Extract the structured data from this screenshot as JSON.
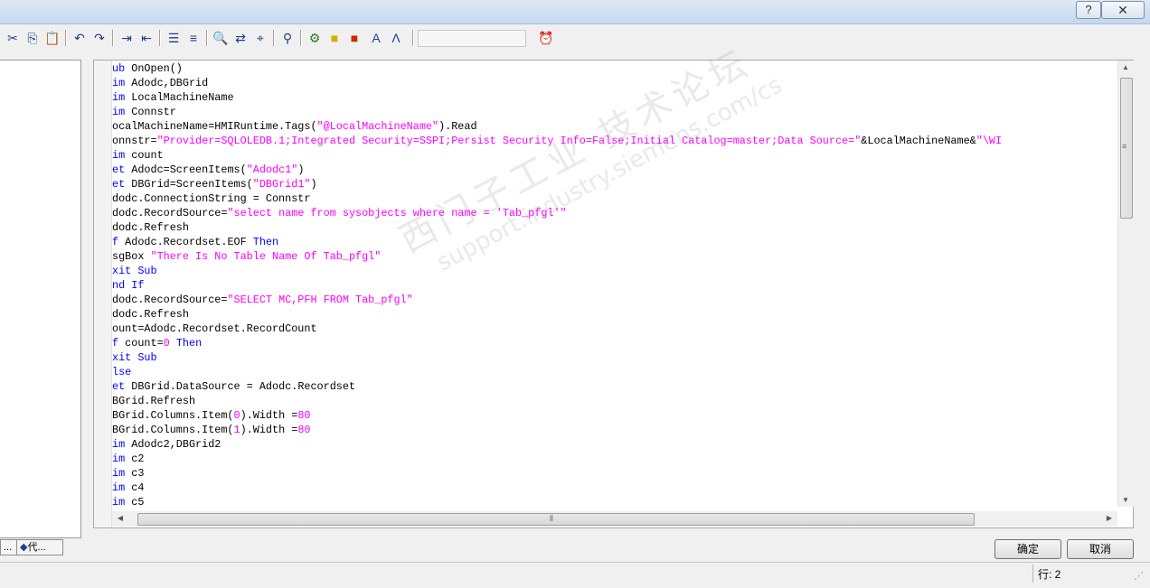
{
  "window": {
    "title": "",
    "help_label": "?",
    "close_label": "✕"
  },
  "toolbar": {
    "buttons": [
      {
        "name": "cut-button",
        "icon": "scissors-icon",
        "glyph": "✂"
      },
      {
        "name": "copy-button",
        "icon": "copy-icon",
        "glyph": "⎘"
      },
      {
        "name": "paste-button",
        "icon": "paste-icon",
        "glyph": "📋"
      },
      {
        "name": "undo-button",
        "icon": "undo-icon",
        "glyph": "↶"
      },
      {
        "name": "redo-button",
        "icon": "redo-icon",
        "glyph": "↷"
      },
      {
        "name": "indent-button",
        "icon": "indent-icon",
        "glyph": "⇥"
      },
      {
        "name": "outdent-button",
        "icon": "outdent-icon",
        "glyph": "⇤"
      },
      {
        "name": "comment-button",
        "icon": "comment-lines-icon",
        "glyph": "☰"
      },
      {
        "name": "uncomment-button",
        "icon": "uncomment-lines-icon",
        "glyph": "≡"
      },
      {
        "name": "find-button",
        "icon": "binoculars-icon",
        "glyph": "🔍"
      },
      {
        "name": "replace-button",
        "icon": "replace-icon",
        "glyph": "⇄"
      },
      {
        "name": "goto-button",
        "icon": "goto-icon",
        "glyph": "⌖"
      },
      {
        "name": "bookmark-button",
        "icon": "bookmark-icon",
        "glyph": "⚲"
      },
      {
        "name": "compile-button",
        "icon": "compile-icon",
        "glyph": "⚙"
      },
      {
        "name": "object-button",
        "icon": "yellow-cube-icon",
        "glyph": "■"
      },
      {
        "name": "object-red-button",
        "icon": "red-cube-icon",
        "glyph": "■"
      },
      {
        "name": "tags-button",
        "icon": "tag-a-icon",
        "glyph": "A"
      },
      {
        "name": "property-button",
        "icon": "compass-icon",
        "glyph": "Λ"
      },
      {
        "name": "timer-button",
        "icon": "alarm-clock-icon",
        "glyph": "⏰"
      }
    ],
    "search_value": ""
  },
  "tree_pane": {
    "tabs": [
      {
        "label": "..."
      },
      {
        "label": "代..."
      }
    ]
  },
  "editor": {
    "lines": [
      [
        {
          "t": "ub",
          "c": "k"
        },
        {
          "t": " OnOpen()",
          "c": ""
        }
      ],
      [
        {
          "t": "im",
          "c": "k"
        },
        {
          "t": " Adodc,DBGrid",
          "c": ""
        }
      ],
      [
        {
          "t": "im",
          "c": "k"
        },
        {
          "t": " LocalMachineName",
          "c": ""
        }
      ],
      [
        {
          "t": "im",
          "c": "k"
        },
        {
          "t": " Connstr",
          "c": ""
        }
      ],
      [
        {
          "t": "ocalMachineName=HMIRuntime.Tags(",
          "c": ""
        },
        {
          "t": "\"@LocalMachineName\"",
          "c": "s"
        },
        {
          "t": ").Read",
          "c": ""
        }
      ],
      [
        {
          "t": "onnstr=",
          "c": ""
        },
        {
          "t": "\"Provider=SQLOLEDB.1;Integrated Security=SSPI;Persist Security Info=False;Initial Catalog=master;Data Source=\"",
          "c": "s"
        },
        {
          "t": "&LocalMachineName&",
          "c": ""
        },
        {
          "t": "\"\\WI",
          "c": "s"
        }
      ],
      [
        {
          "t": "im",
          "c": "k"
        },
        {
          "t": " count",
          "c": ""
        }
      ],
      [
        {
          "t": "et",
          "c": "k"
        },
        {
          "t": " Adodc=ScreenItems(",
          "c": ""
        },
        {
          "t": "\"Adodc1\"",
          "c": "s"
        },
        {
          "t": ")",
          "c": ""
        }
      ],
      [
        {
          "t": "et",
          "c": "k"
        },
        {
          "t": " DBGrid=ScreenItems(",
          "c": ""
        },
        {
          "t": "\"DBGrid1\"",
          "c": "s"
        },
        {
          "t": ")",
          "c": ""
        }
      ],
      [
        {
          "t": "dodc.ConnectionString = Connstr",
          "c": ""
        }
      ],
      [
        {
          "t": "dodc.RecordSource=",
          "c": ""
        },
        {
          "t": "\"select name from sysobjects where name = 'Tab_pfgl'\"",
          "c": "s"
        }
      ],
      [
        {
          "t": "dodc.Refresh",
          "c": ""
        }
      ],
      [
        {
          "t": "f",
          "c": "k"
        },
        {
          "t": " Adodc.Recordset.EOF ",
          "c": ""
        },
        {
          "t": "Then",
          "c": "k"
        }
      ],
      [
        {
          "t": "sgBox ",
          "c": ""
        },
        {
          "t": "\"There Is No Table Name Of Tab_pfgl\"",
          "c": "s"
        }
      ],
      [
        {
          "t": "xit Sub",
          "c": "k"
        }
      ],
      [
        {
          "t": "nd If",
          "c": "k"
        }
      ],
      [
        {
          "t": "dodc.RecordSource=",
          "c": ""
        },
        {
          "t": "\"SELECT MC,PFH FROM Tab_pfgl\"",
          "c": "s"
        }
      ],
      [
        {
          "t": "dodc.Refresh",
          "c": ""
        }
      ],
      [
        {
          "t": "ount=Adodc.Recordset.RecordCount",
          "c": ""
        }
      ],
      [
        {
          "t": "f",
          "c": "k"
        },
        {
          "t": " count=",
          "c": ""
        },
        {
          "t": "0",
          "c": "s"
        },
        {
          "t": " ",
          "c": ""
        },
        {
          "t": "Then",
          "c": "k"
        }
      ],
      [
        {
          "t": "xit Sub",
          "c": "k"
        }
      ],
      [
        {
          "t": "lse",
          "c": "k"
        }
      ],
      [
        {
          "t": "et",
          "c": "k"
        },
        {
          "t": " DBGrid.DataSource = Adodc.Recordset",
          "c": ""
        }
      ],
      [
        {
          "t": "BGrid.Refresh",
          "c": ""
        }
      ],
      [
        {
          "t": "BGrid.Columns.Item(",
          "c": ""
        },
        {
          "t": "0",
          "c": "s"
        },
        {
          "t": ").Width =",
          "c": ""
        },
        {
          "t": "80",
          "c": "s"
        }
      ],
      [
        {
          "t": "BGrid.Columns.Item(",
          "c": ""
        },
        {
          "t": "1",
          "c": "s"
        },
        {
          "t": ").Width =",
          "c": ""
        },
        {
          "t": "80",
          "c": "s"
        }
      ],
      [
        {
          "t": "im",
          "c": "k"
        },
        {
          "t": " Adodc2,DBGrid2",
          "c": ""
        }
      ],
      [
        {
          "t": "im",
          "c": "k"
        },
        {
          "t": " c2",
          "c": ""
        }
      ],
      [
        {
          "t": "im",
          "c": "k"
        },
        {
          "t": " c3",
          "c": ""
        }
      ],
      [
        {
          "t": "im",
          "c": "k"
        },
        {
          "t": " c4",
          "c": ""
        }
      ],
      [
        {
          "t": "im",
          "c": "k"
        },
        {
          "t": " c5",
          "c": ""
        }
      ]
    ],
    "colors": {
      "keyword": "#0000ff",
      "string": "#ff00ff",
      "text": "#000000"
    }
  },
  "watermark": {
    "line1": "西门子工业 技术论坛",
    "line2": "support.industry.siemens.com/cs"
  },
  "buttons": {
    "ok_label": "确定",
    "cancel_label": "取消"
  },
  "status": {
    "line_label": "行: 2"
  }
}
